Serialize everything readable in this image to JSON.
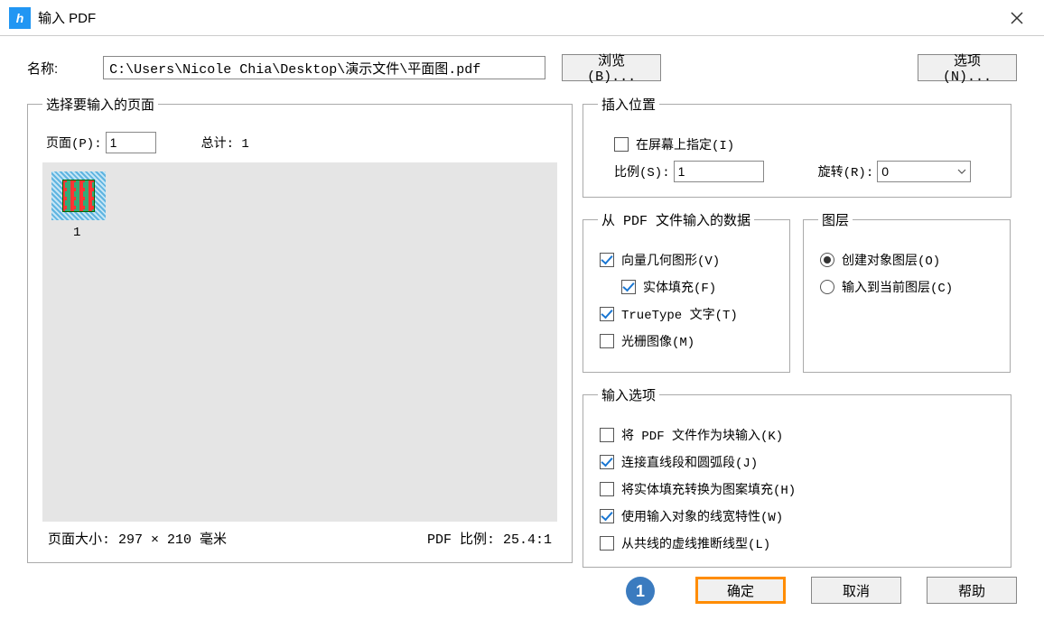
{
  "titlebar": {
    "app_icon_text": "h",
    "title": "  输入 PDF"
  },
  "name_label": "名称:",
  "path_value": "C:\\Users\\Nicole Chia\\Desktop\\演示文件\\平面图.pdf",
  "browse_btn": "浏览(B)...",
  "options_btn": "选项(N)...",
  "pages_fs": {
    "legend": "选择要输入的页面",
    "page_label": "页面(P):",
    "page_value": "1",
    "total_label": "总计: 1",
    "thumb_label": "1",
    "page_size": "页面大小: 297 × 210 毫米",
    "pdf_scale": "PDF 比例: 25.4:1"
  },
  "insert_fs": {
    "legend": "插入位置",
    "specify_on_screen": "在屏幕上指定(I)",
    "scale_label": "比例(S):",
    "scale_value": "1",
    "rotate_label": "旋转(R):",
    "rotate_value": "0"
  },
  "pdfdata_fs": {
    "legend": "从 PDF 文件输入的数据",
    "vector": "向量几何图形(V)",
    "solid_fill": "实体填充(F)",
    "truetype": "TrueType 文字(T)",
    "raster": "光栅图像(M)"
  },
  "layer_fs": {
    "legend": "图层",
    "create_obj": "创建对象图层(O)",
    "import_cur": "输入到当前图层(C)"
  },
  "inputopt_fs": {
    "legend": "输入选项",
    "as_block": "将 PDF 文件作为块输入(K)",
    "join_lines": "连接直线段和圆弧段(J)",
    "solid_hatch": "将实体填充转换为图案填充(H)",
    "use_lineweight": "使用输入对象的线宽特性(W)",
    "infer_linetype": "从共线的虚线推断线型(L)"
  },
  "buttons": {
    "ok": "确定",
    "cancel": "取消",
    "help": "帮助"
  },
  "badge_text": "1"
}
